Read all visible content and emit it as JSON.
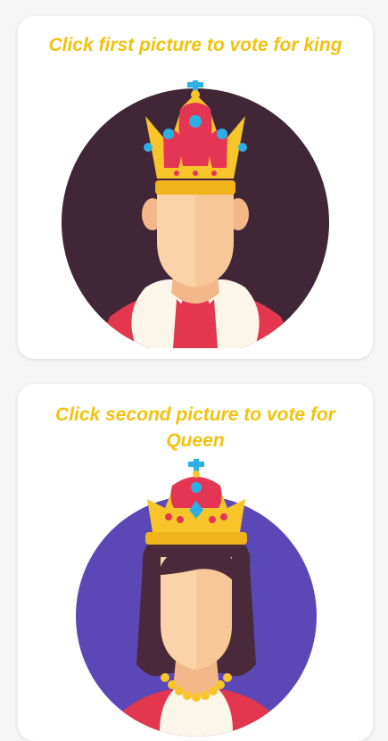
{
  "cards": [
    {
      "title": "Click first picture to vote for king",
      "avatar": "king-avatar",
      "background_color": "#402636"
    },
    {
      "title": "Click second picture to vote for Queen",
      "avatar": "queen-avatar",
      "background_color": "#5b47b5"
    }
  ],
  "colors": {
    "title": "#f4c20d",
    "crown_gold": "#f7c52a",
    "crown_red": "#e53554",
    "jewel_blue": "#2bb0e5",
    "skin": "#fbd3a8",
    "skin_shadow": "#f3b88a",
    "robe_red": "#e2374f",
    "fur_white": "#fbf5ea"
  }
}
